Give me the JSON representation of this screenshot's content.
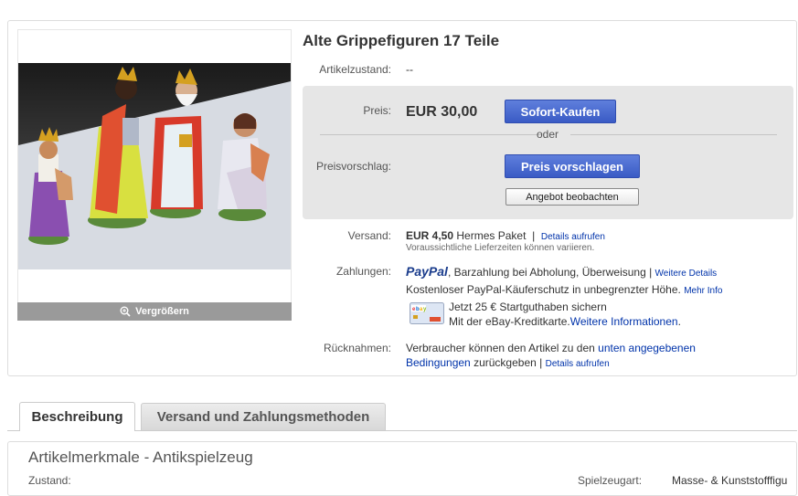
{
  "listing": {
    "title": "Alte Grippefiguren 17 Teile",
    "zoom_label": "Vergrößern",
    "condition_label": "Artikelzustand:",
    "condition_value": "--",
    "price_label": "Preis:",
    "price_value": "EUR 30,00",
    "buy_now_label": "Sofort-Kaufen",
    "or_label": "oder",
    "offer_label": "Preisvorschlag:",
    "offer_button": "Preis vorschlagen",
    "watch_button": "Angebot beobachten",
    "shipping_label": "Versand:",
    "shipping_price": "EUR 4,50",
    "shipping_method": "Hermes Paket",
    "shipping_sep": "|",
    "shipping_details": "Details aufrufen",
    "shipping_note": "Voraussichtliche Lieferzeiten können variieren.",
    "payment_label": "Zahlungen:",
    "paypal_logo": "PayPal",
    "payment_methods": ", Barzahlung bei Abholung, Überweisung |",
    "payment_more": "Weitere Details",
    "buyer_protection": "Kostenloser PayPal-Käuferschutz in unbegrenzter Höhe.",
    "buyer_protection_more": "Mehr Info",
    "credit_line1": "Jetzt 25 € Startguthaben sichern",
    "credit_line2": "Mit der eBay-Kreditkarte.",
    "credit_more": "Weitere Informationen",
    "credit_dot": ".",
    "returns_label": "Rücknahmen:",
    "returns_text1": "Verbraucher können den Artikel zu den",
    "returns_link1": "unten angegebenen",
    "returns_link2": "Bedingungen",
    "returns_text2": "zurückgeben |",
    "returns_details": "Details aufrufen"
  },
  "tabs": [
    {
      "label": "Beschreibung",
      "active": true
    },
    {
      "label": "Versand und Zahlungsmethoden",
      "active": false
    }
  ],
  "description": {
    "heading": "Artikelmerkmale - Antikspielzeug",
    "row_left_label": "Zustand:",
    "row_right_label": "Spielzeugart:",
    "row_right_value": "Masse- & Kunststofffigu"
  },
  "colors": {
    "link": "#0033aa",
    "button_blue": "#3a5bc5",
    "panel_bg": "#e6e6e6"
  },
  "icons": {
    "zoom": "magnifier-icon",
    "paypal": "paypal-logo",
    "card": "credit-card-icon"
  }
}
